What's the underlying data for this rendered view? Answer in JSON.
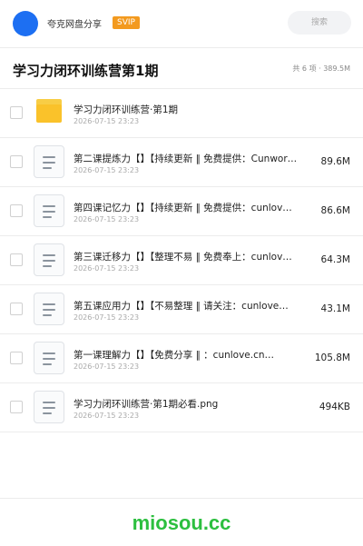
{
  "header": {
    "username": "夸克网盘分享",
    "badge": "SVIP",
    "search_placeholder": "搜索"
  },
  "folder": {
    "title": "学习力闭环训练营第1期",
    "summary": "共 6 项 · 389.5M"
  },
  "files": [
    {
      "name": "学习力闭环训练营·第1期",
      "date": "2026-07-15 23:23",
      "size": "",
      "icon": "folder-icon"
    },
    {
      "name": "第二课提炼力【】【持续更新 ‖ 免费提供：Cunwor…",
      "date": "2026-07-15 23:23",
      "size": "89.6M",
      "icon": "document-icon"
    },
    {
      "name": "第四课记忆力【】【持续更新 ‖ 免费提供：cunlov…",
      "date": "2026-07-15 23:23",
      "size": "86.6M",
      "icon": "document-icon"
    },
    {
      "name": "第三课迁移力【】【整理不易 ‖ 免费奉上：cunlov…",
      "date": "2026-07-15 23:23",
      "size": "64.3M",
      "icon": "document-icon"
    },
    {
      "name": "第五课应用力【】【不易整理 ‖ 请关注：cunlove…",
      "date": "2026-07-15 23:23",
      "size": "43.1M",
      "icon": "document-icon"
    },
    {
      "name": "第一课理解力【】【免费分享 ‖ ：cunlove.cn…",
      "date": "2026-07-15 23:23",
      "size": "105.8M",
      "icon": "document-icon"
    },
    {
      "name": "学习力闭环训练营·第1期必看.png",
      "date": "2026-07-15 23:23",
      "size": "494KB",
      "icon": "document-icon"
    }
  ],
  "footer": {
    "brand": "miosou.cc"
  },
  "colors": {
    "avatar": "#1d6ff2",
    "svip_badge": "#f39a1f",
    "folder": "#fac22a",
    "brand": "#2cbf3f"
  }
}
